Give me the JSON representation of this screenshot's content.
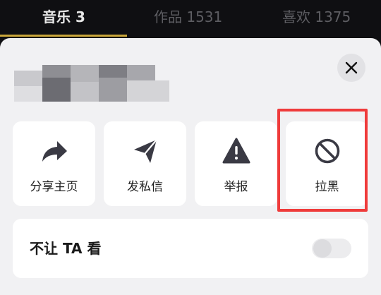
{
  "tabs": [
    {
      "label": "音乐 3",
      "active": true
    },
    {
      "label": "作品 1531",
      "active": false
    },
    {
      "label": "喜欢 1375",
      "active": false
    }
  ],
  "colors": {
    "accent_underline": "#c9a63a",
    "highlight": "#ef3b3b",
    "sheet_bg": "#f1f1f3"
  },
  "sheet": {
    "close_icon": "close-icon",
    "actions": [
      {
        "label": "分享主页",
        "icon": "share-arrow-icon"
      },
      {
        "label": "发私信",
        "icon": "send-message-icon"
      },
      {
        "label": "举报",
        "icon": "warning-icon"
      },
      {
        "label": "拉黑",
        "icon": "block-icon"
      }
    ],
    "hide_from": {
      "label": "不让 TA 看",
      "enabled": false
    }
  }
}
